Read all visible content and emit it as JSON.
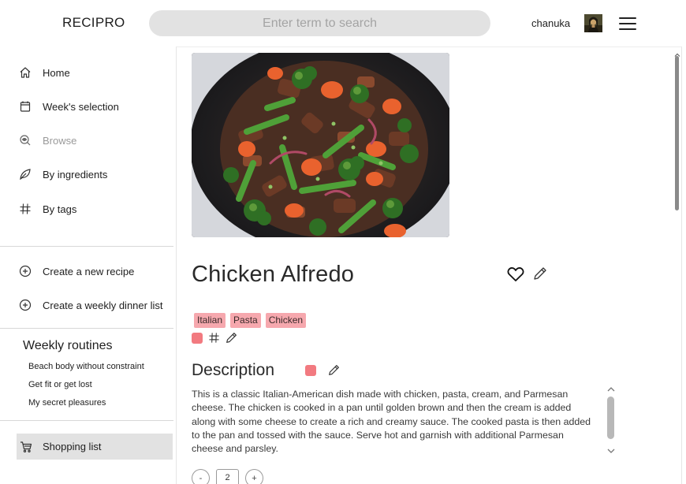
{
  "header": {
    "logo": "RECIPRO",
    "search_placeholder": "Enter term to search",
    "username": "chanuka"
  },
  "sidebar": {
    "nav": [
      {
        "label": "Home",
        "icon": "home-icon"
      },
      {
        "label": "Week's selection",
        "icon": "calendar-icon"
      },
      {
        "label": "Browse",
        "icon": "browse-icon",
        "state": "disabled"
      },
      {
        "label": "By ingredients",
        "icon": "leaf-icon"
      },
      {
        "label": "By tags",
        "icon": "hashtag-icon"
      }
    ],
    "actions": [
      {
        "label": "Create a new recipe",
        "icon": "plus-circle-icon"
      },
      {
        "label": "Create a weekly dinner list",
        "icon": "plus-circle-icon"
      }
    ],
    "routines_title": "Weekly routines",
    "routines": [
      "Beach body without constraint",
      "Get fit or get lost",
      "My secret pleasures"
    ],
    "shopping_label": "Shopping list",
    "shopping_icon": "cart-icon"
  },
  "recipe": {
    "title": "Chicken Alfredo",
    "tags": [
      "Italian",
      "Pasta",
      "Chicken"
    ],
    "description_heading": "Description",
    "description": "This is a classic Italian-American dish made with chicken, pasta, cream, and Parmesan cheese. The chicken is cooked in a pan until golden brown and then the cream is added along with some cheese to create a rich and creamy sauce. The cooked pasta is then added to the pan and tossed with the sauce. Serve hot and garnish with additional Parmesan cheese and parsley.",
    "servings": {
      "minus": "-",
      "value": "2",
      "plus": "+"
    }
  },
  "colors": {
    "tag_bg": "#f6a8ae",
    "swatch": "#f27a80",
    "search_bg": "#e2e2e2"
  }
}
